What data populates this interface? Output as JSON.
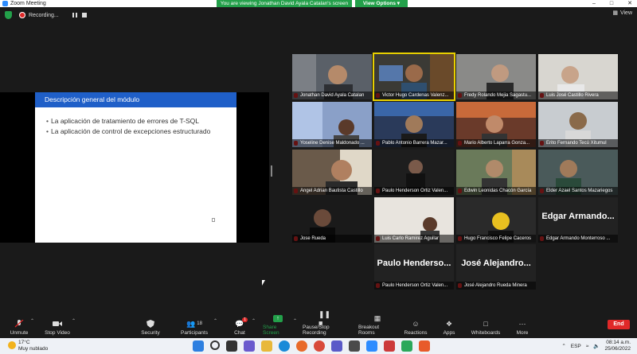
{
  "window": {
    "title": "Zoom Meeting",
    "banner": "You are viewing Jonathan David Ayala Catalan's screen",
    "view_options": "View Options",
    "view_label": "View"
  },
  "recording": {
    "label": "Recording..."
  },
  "slide": {
    "heading": "Descripción general del módulo",
    "bullets": [
      "La aplicación de tratamiento de errores de T-SQL",
      "La aplicación de control de excepciones estructurado"
    ]
  },
  "participants": [
    "Jonathan David Ayala Catalan",
    "Victor Hugo Cardenas Valenz...",
    "Fredy Rolando Mejia Sagastu...",
    "Luis José Castillo Rivera",
    "Yoseline Denise Maldonado ...",
    "Pablo Antonio Barrera Mazar...",
    "Mario Alberto Laparra Gonza...",
    "Erito Fernando Tecú Xitumul",
    "Angel Adrian Bautista Castillo",
    "Paulo Henderson Ortiz Valen...",
    "Edwin Leonidas Chacón García",
    "Elder Azael Santos Mazariegos",
    "Jose Rueda",
    "Luis Carlo Ramirez Aguilar",
    "Hugo Francisco Felipe Caceros",
    "Edgar Armando Monterroso ...",
    "Paulo Henderson Ortiz Valen...",
    "José Alejandro Rueda Minera"
  ],
  "big_names": {
    "edgar": "Edgar Armando...",
    "paulo": "Paulo Henderso...",
    "jose": "José Alejandro..."
  },
  "toolbar": {
    "unmute": "Unmute",
    "stop_video": "Stop Video",
    "security": "Security",
    "participants": "Participants",
    "participants_count": "18",
    "chat": "Chat",
    "chat_badge": "1",
    "share_screen": "Share Screen",
    "pause_recording": "Pause/Stop Recording",
    "breakout": "Breakout Rooms",
    "reactions": "Reactions",
    "apps": "Apps",
    "whiteboards": "Whiteboards",
    "more": "More",
    "end": "End"
  },
  "taskbar": {
    "temperature": "17°C",
    "weather": "Muy nublado",
    "language": "ESP",
    "time": "08:14 a.m.",
    "date": "25/06/2022"
  },
  "colors": {
    "accent_green": "#23a04a",
    "slide_blue": "#1f5fc8",
    "end_red": "#e02828",
    "active_speaker": "#e8d000"
  }
}
